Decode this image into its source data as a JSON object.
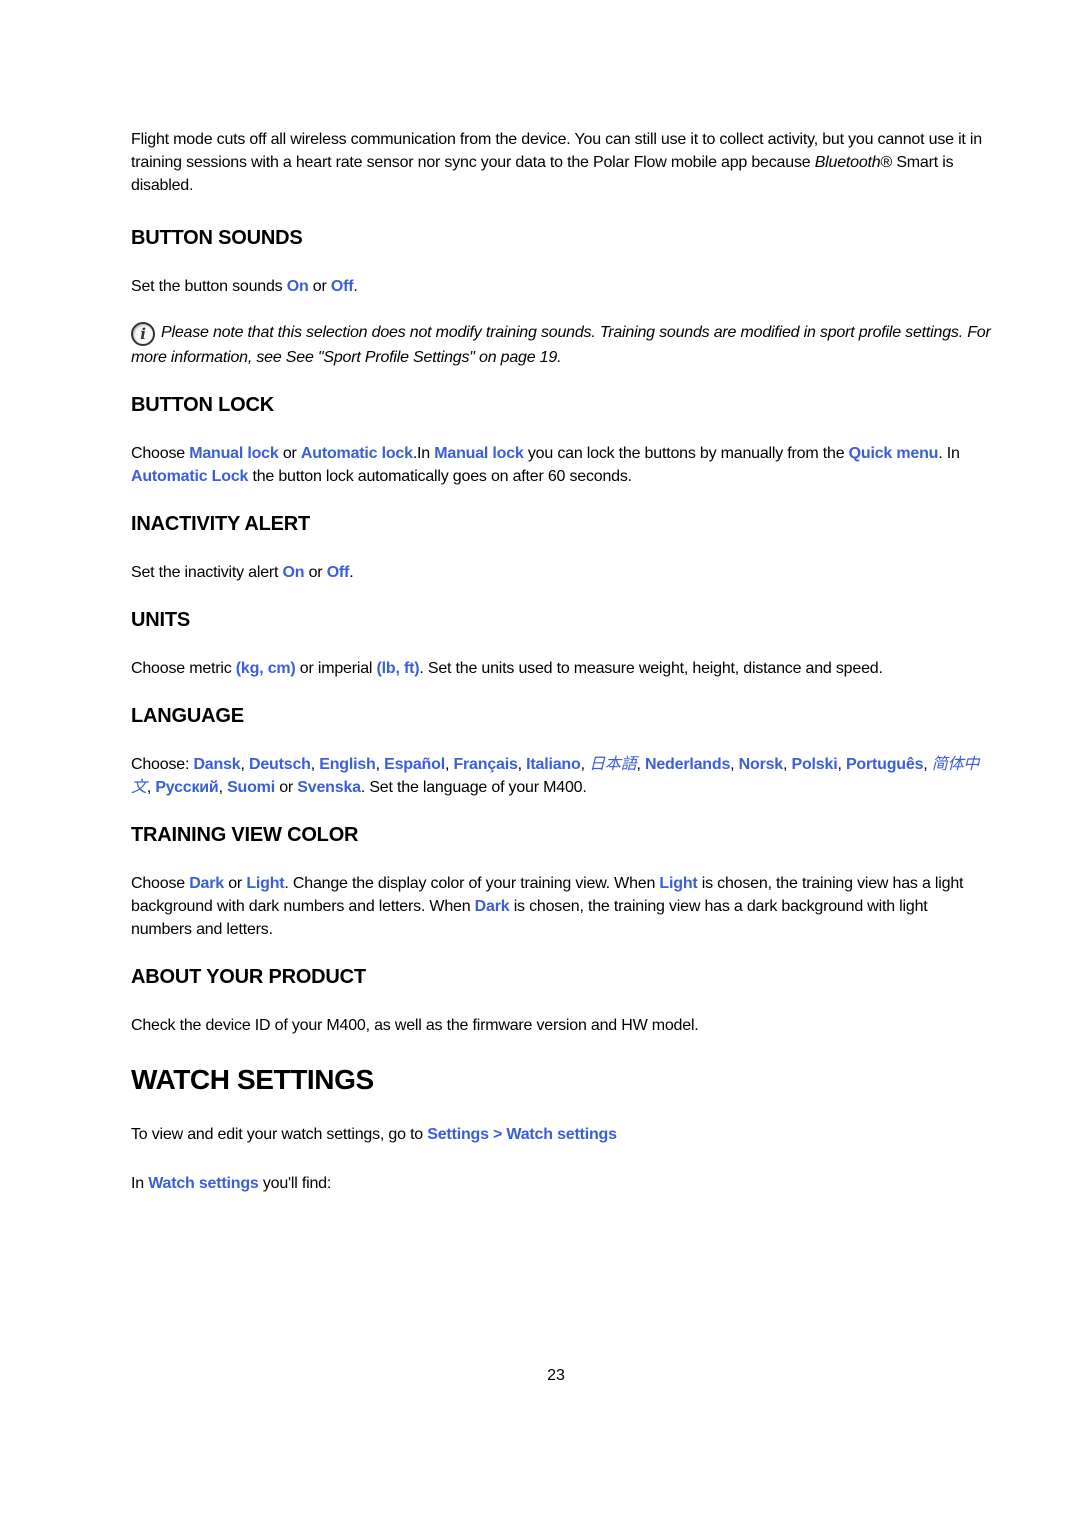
{
  "intro": {
    "text_1": "Flight mode cuts off all wireless communication from the device. You can still use it to collect activity, but you cannot use it in training sessions with a heart rate sensor nor sync your data to the Polar Flow mobile app because ",
    "text_italic": "Bluetooth",
    "text_2": "® Smart is disabled."
  },
  "button_sounds": {
    "heading": "BUTTON SOUNDS",
    "text_1": "Set the button sounds ",
    "on": "On",
    "text_2": " or ",
    "off": "Off",
    "text_3": ".",
    "note_icon": "info-icon",
    "note_icon_glyph": "i",
    "note": "Please note that this selection does not modify training sounds. Training sounds are modified in sport profile settings. For more information, see See \"Sport Profile Settings\" on page 19."
  },
  "button_lock": {
    "heading": "BUTTON LOCK",
    "t1": "Choose ",
    "manual_lock": "Manual lock",
    "t2": " or ",
    "automatic_lock": "Automatic lock",
    "t3": ".In ",
    "manual_lock_2": "Manual lock",
    "t4": " you can lock the buttons by manually from the ",
    "quick_menu": "Quick menu",
    "t5": ". In ",
    "automatic_lock_2": "Automatic Lock",
    "t6": " the button lock automatically goes on after 60 seconds."
  },
  "inactivity_alert": {
    "heading": "INACTIVITY ALERT",
    "text_1": "Set the inactivity alert ",
    "on": "On",
    "text_2": " or ",
    "off": "Off",
    "text_3": "."
  },
  "units": {
    "heading": "UNITS",
    "t1": "Choose metric ",
    "metric": "(kg, cm)",
    "t2": " or imperial ",
    "imperial": "(lb, ft)",
    "t3": ". Set the units used to measure weight, height, distance and speed."
  },
  "language": {
    "heading": "LANGUAGE",
    "prefix": "Choose: ",
    "options": [
      "Dansk",
      "Deutsch",
      "English",
      "Español",
      "Français",
      "Italiano",
      "日本語",
      "Nederlands",
      "Norsk",
      "Polski",
      "Português",
      "简体中文",
      "Русский",
      "Suomi",
      "Svenska"
    ],
    "sep": ", ",
    "or": " or ",
    "suffix": ". Set the language of your M400."
  },
  "training_view_color": {
    "heading": "TRAINING VIEW COLOR",
    "t1": "Choose ",
    "dark": "Dark",
    "t2": " or ",
    "light": "Light",
    "t3": ". Change the display color of your training view. When ",
    "light_2": "Light",
    "t4": " is chosen, the training view has a light background with dark numbers and letters. When ",
    "dark_2": "Dark",
    "t5": " is chosen, the training view has a dark background with light numbers and letters."
  },
  "about_product": {
    "heading": "ABOUT YOUR PRODUCT",
    "text": "Check the device ID of your M400, as well as the firmware version and HW model."
  },
  "watch_settings": {
    "heading": "WATCH SETTINGS",
    "t1": "To view and edit your watch settings, go to ",
    "path": "Settings > Watch settings",
    "t2": "In ",
    "watch_settings_link": "Watch settings",
    "t3": " you'll find:"
  },
  "page_number": "23",
  "colors": {
    "link": "#3a5fd9",
    "text": "#000000"
  }
}
